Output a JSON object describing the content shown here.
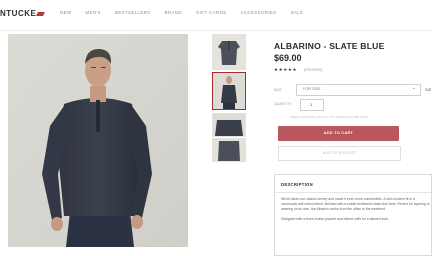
{
  "brand": {
    "logo_text": "NTUCKE",
    "accent_color": "#b23a3f"
  },
  "nav": {
    "items": [
      "NEW",
      "MEN'S",
      "BESTSELLERS",
      "BRAND",
      "GIFT CARDS",
      "ACCESSORIES",
      "SALE"
    ]
  },
  "product": {
    "title": "ALBARINO - SLATE BLUE",
    "price": "$69.00",
    "stars": "★★★★★",
    "rating": 5,
    "reviews_text": "(REVIEWS)",
    "size_label": "SIZE",
    "size_value": "FOR SIZE",
    "size_guide": "SIZ",
    "qty_label": "QUANTITY",
    "qty_value": "1",
    "ship_note": "FREE SHIPPING ON ALL US ORDERS OVER $100",
    "add_to_cart": "ADD TO CART",
    "wishlist": "ADD TO WISHLIST"
  },
  "description": {
    "heading": "DESCRIPTION",
    "paragraphs": [
      "We've taken our classic henley and made it even more comfortable. A slim modern fit in a luxuriously soft cotton blend, finished with a subtle heathered slate blue tone. Perfect for layering or wearing on its own, the Albarino works from the office to the weekend.",
      "Designed with a three-button placket and ribbed cuffs for a tailored look."
    ]
  },
  "thumbnails": {
    "active_index": 1
  }
}
